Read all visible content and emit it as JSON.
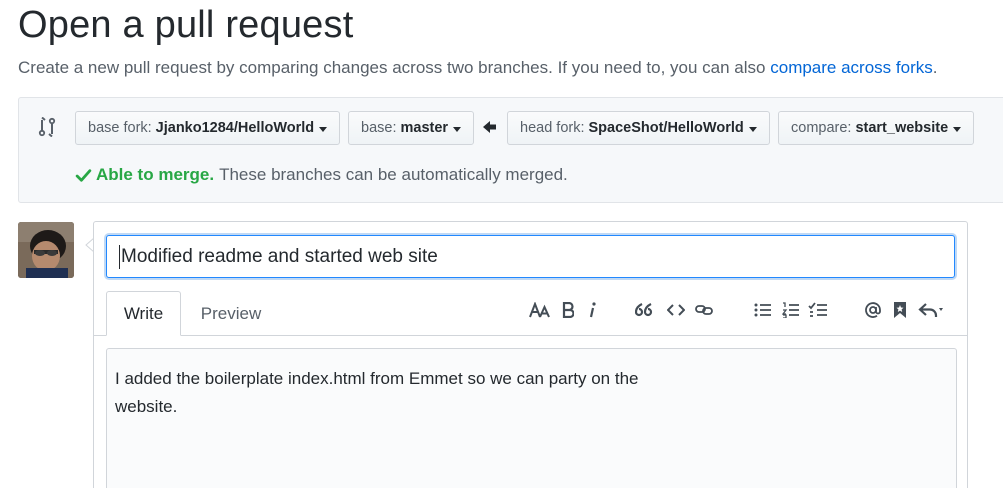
{
  "header": {
    "title": "Open a pull request",
    "subtitle_text": "Create a new pull request by comparing changes across two branches. If you need to, you can also",
    "subtitle_link": "compare across forks",
    "subtitle_end": "."
  },
  "compare": {
    "base_fork_label": "base fork:",
    "base_fork_value": "Jjanko1284/HelloWorld",
    "base_label": "base:",
    "base_value": "master",
    "head_fork_label": "head fork:",
    "head_fork_value": "SpaceShot/HelloWorld",
    "compare_label": "compare:",
    "compare_value": "start_website"
  },
  "merge": {
    "status": "Able to merge.",
    "message": "These branches can be automatically merged."
  },
  "pr": {
    "title_value": "Modified readme and started web site",
    "tabs": [
      {
        "label": "Write",
        "selected": true
      },
      {
        "label": "Preview",
        "selected": false
      }
    ],
    "body_lines": [
      "I added the boilerplate index.html from Emmet so we can party on the",
      "website."
    ]
  },
  "toolbar": {
    "icons": [
      "text-size-icon",
      "bold-icon",
      "italic-icon",
      "quote-icon",
      "code-icon",
      "link-icon",
      "unordered-list-icon",
      "ordered-list-icon",
      "task-list-icon",
      "mention-icon",
      "bookmark-icon",
      "reply-icon"
    ]
  },
  "colors": {
    "link": "#0366d6",
    "success": "#28a745",
    "focus": "#2188ff"
  }
}
